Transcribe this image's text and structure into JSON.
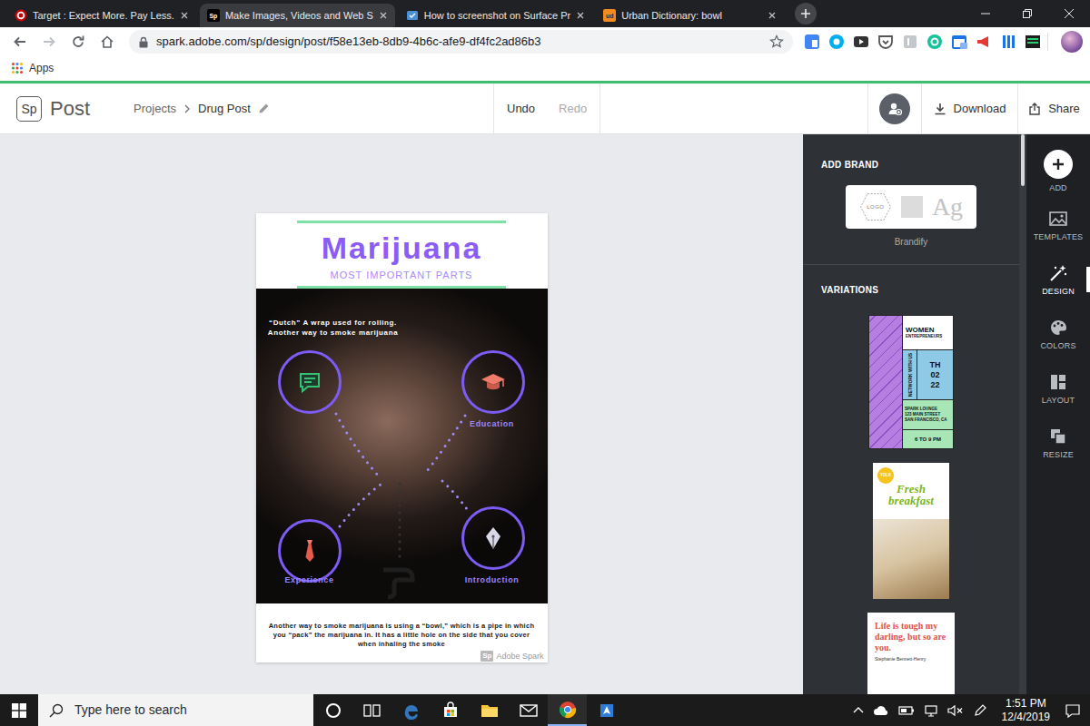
{
  "browser": {
    "tabs": [
      {
        "label": "Target : Expect More. Pay Less.",
        "selected": false
      },
      {
        "label": "Make Images, Videos and Web S",
        "selected": true,
        "icon_text": "Sp"
      },
      {
        "label": "How to screenshot on Surface Pr",
        "selected": false
      },
      {
        "label": "Urban Dictionary: bowl",
        "selected": false,
        "icon_text": "ud"
      }
    ],
    "url": "spark.adobe.com/sp/design/post/f58e13eb-8db9-4b6c-afe9-df4fc2ad86b3",
    "bookmarks": [
      "Apps"
    ]
  },
  "header": {
    "logo": "Sp",
    "product": "Post",
    "breadcrumb": [
      "Projects",
      "Drug Post"
    ],
    "history": [
      {
        "label": "Undo",
        "disabled": false
      },
      {
        "label": "Redo",
        "disabled": true
      }
    ],
    "actions": [
      "Download",
      "Share"
    ]
  },
  "poster": {
    "title": "Marijuana",
    "subtitle": "MOST IMPORTANT PARTS",
    "intro": "“Dutch” A wrap used for rolling. Another way to smoke marijuana",
    "node_labels": [
      "Education",
      "Experience",
      "Introduction"
    ],
    "footer": "Another way to smoke marijuana is using a “bowl,” which is a pipe in which you “pack” the marijuana in. It has a little hole on the side that you cover when inhaling the smoke",
    "watermark": {
      "logo": "Sp",
      "label": "Adobe Spark"
    }
  },
  "panel": {
    "brand_heading": "ADD BRAND",
    "brand_logo": "LOGO",
    "brand_font": "Ag",
    "brandify": "Brandify",
    "variations_heading": "VARIATIONS",
    "variations": [
      {
        "kind": "event",
        "title": "WOMEN",
        "subtitle": "ENTREPRENEURS",
        "side": "NETWORK WITH US",
        "date": [
          "TH",
          "02",
          "22"
        ],
        "venue": [
          "SPARK LOUNGE",
          "123 MAIN STREET",
          "SAN FRANCISCO, CA"
        ],
        "time": "6 TO 9 PM"
      },
      {
        "kind": "food",
        "badge": "YOLK",
        "title": "Fresh breakfast"
      },
      {
        "kind": "quote",
        "quote": "Life is tough my darling, but so are you.",
        "author": "Stephanie Bennett-Henry"
      }
    ]
  },
  "toolbar": [
    {
      "label": "ADD",
      "selected": false
    },
    {
      "label": "TEMPLATES",
      "selected": false
    },
    {
      "label": "DESIGN",
      "selected": true
    },
    {
      "label": "COLORS",
      "selected": false
    },
    {
      "label": "LAYOUT",
      "selected": false
    },
    {
      "label": "RESIZE",
      "selected": false
    }
  ],
  "taskbar": {
    "search": "Type here to search",
    "time": "1:51 PM",
    "date": "12/4/2019"
  }
}
